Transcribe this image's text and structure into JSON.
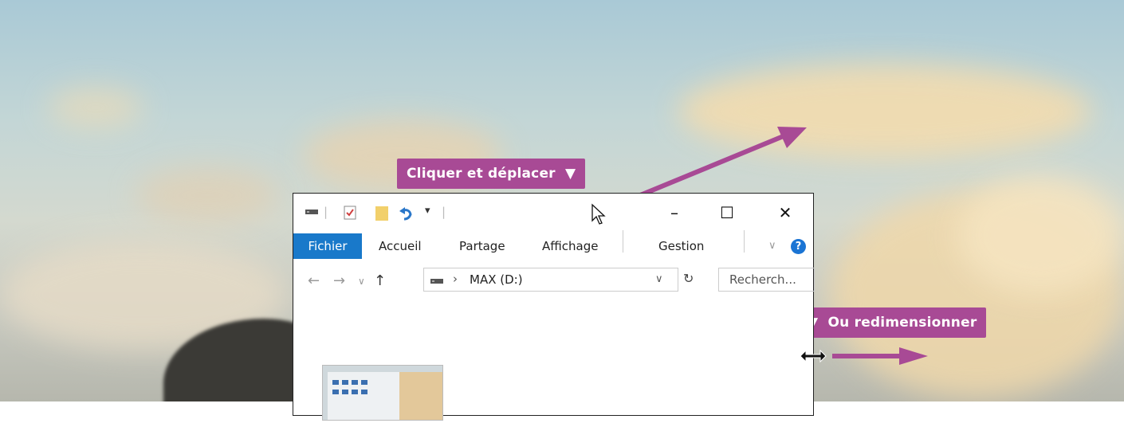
{
  "annotations": {
    "move_label": "Cliquer et déplacer",
    "resize_label": "Ou redimensionner",
    "accent_color": "#a84a95"
  },
  "window": {
    "quick_access": {
      "icons": [
        "drive-icon",
        "properties-icon",
        "new-folder-icon",
        "undo-icon",
        "customize-qa-icon"
      ]
    },
    "controls": {
      "minimize": "–",
      "maximize": "☐",
      "close": "✕"
    },
    "ribbon": {
      "tabs": [
        "Fichier",
        "Accueil",
        "Partage",
        "Affichage",
        "Gestion"
      ],
      "active_tab_color": "#1979ca"
    },
    "address": {
      "path_separator": "›",
      "location": "MAX (D:)",
      "dropdown": "∨",
      "refresh": "↻"
    },
    "search": {
      "placeholder": "Recherch..."
    }
  }
}
